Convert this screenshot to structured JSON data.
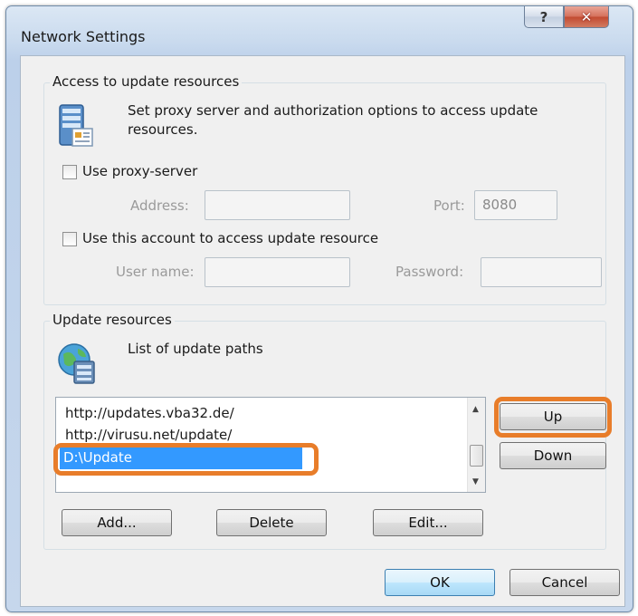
{
  "window": {
    "title": "Network Settings",
    "help_glyph": "?",
    "close_glyph": "✕"
  },
  "access_group": {
    "legend": "Access to update resources",
    "description": "Set proxy server and authorization options to access update resources.",
    "icon": "server-settings-icon",
    "use_proxy_label": "Use proxy-server",
    "use_proxy_checked": false,
    "address_label": "Address:",
    "address_value": "",
    "port_label": "Port:",
    "port_value": "8080",
    "use_account_label": "Use this account to access update resource",
    "use_account_checked": false,
    "username_label": "User name:",
    "username_value": "",
    "password_label": "Password:",
    "password_value": ""
  },
  "update_group": {
    "legend": "Update resources",
    "description": "List of update paths",
    "icon": "globe-server-icon",
    "paths": [
      "http://updates.vba32.de/",
      "http://virusu.net/update/",
      "D:\\Update"
    ],
    "selected_index": 2,
    "up_label": "Up",
    "down_label": "Down",
    "add_label": "Add...",
    "delete_label": "Delete",
    "edit_label": "Edit..."
  },
  "footer": {
    "ok_label": "OK",
    "cancel_label": "Cancel"
  },
  "colors": {
    "highlight": "#e87d2a",
    "selection": "#3399ff"
  }
}
